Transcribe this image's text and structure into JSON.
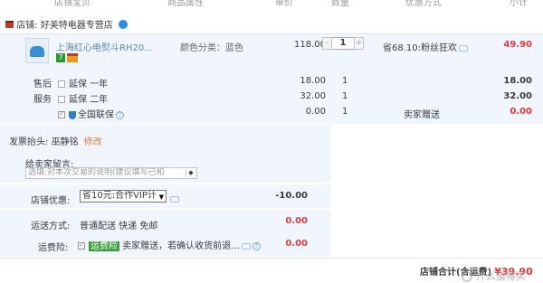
{
  "table_header": {
    "col_product": "店铺宝贝",
    "col_attrs": "商品属性",
    "col_price": "单价",
    "col_qty": "数量",
    "col_promo": "优惠方式",
    "col_subtotal": "小计"
  },
  "shop": {
    "label": "店铺:",
    "name": "好美特电器专营店"
  },
  "item": {
    "title": "上海红心电熨斗RH20...",
    "attr": "颜色分类：蓝色",
    "price": "118.00",
    "qty": "1",
    "minus": "-",
    "plus": "+",
    "promo": "省68.10:粉丝狂欢",
    "subtotal": "49.90",
    "badge_seven": "7"
  },
  "services": [
    {
      "group": "售后",
      "label": "延保 一年",
      "price": "18.00",
      "qty": "1",
      "promo": "",
      "subtotal": "18.00"
    },
    {
      "group": "服务",
      "label": "延保 二年",
      "price": "32.00",
      "qty": "1",
      "promo": "",
      "subtotal": "32.00"
    },
    {
      "group": "",
      "label": "全国联保",
      "price": "0.00",
      "qty": "1",
      "promo": "卖家赠送",
      "subtotal": "0.00"
    }
  ],
  "invoice": {
    "label": "发票抬头:",
    "name": "巫静铭",
    "edit": "修改"
  },
  "message": {
    "label": "给卖家留言:",
    "placeholder": "选填:对本次交易的说明(建议填写已和"
  },
  "shop_discount": {
    "label": "店铺优惠:",
    "selected": "省10元:合作VIP计",
    "amount": "-10.00"
  },
  "shipping": {
    "label": "运送方式:",
    "method": "普通配送 快递 免邮",
    "amount": "0.00"
  },
  "insurance": {
    "label": "运费险:",
    "tag": "运费险",
    "desc": "卖家赠送，若确认收货前退...",
    "amount": "0.00"
  },
  "total": {
    "label": "店铺合计(含运费)",
    "amount": "¥39.90"
  },
  "watermark": "什么值得买"
}
